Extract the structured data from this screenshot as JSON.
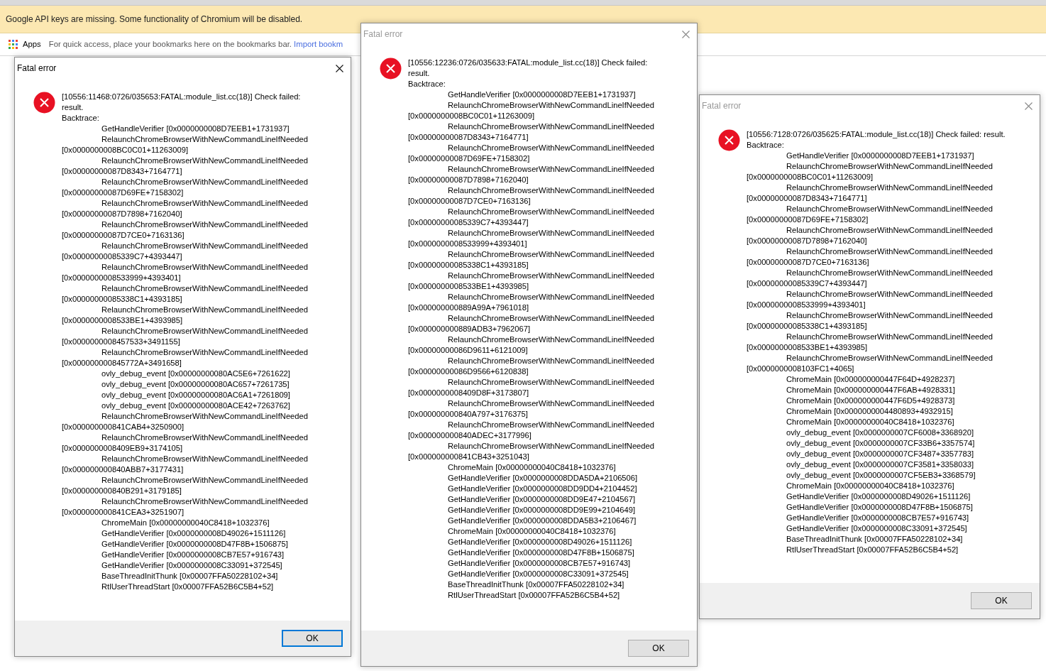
{
  "banner": {
    "text": "Google API keys are missing. Some functionality of Chromium will be disabled."
  },
  "bookmarks_bar": {
    "apps_label": "Apps",
    "hint": "For quick access, place your bookmarks here on the bookmarks bar.",
    "import_link": "Import bookm"
  },
  "dialogs": [
    {
      "title": "Fatal error",
      "active": true,
      "header": "[10556:11468:0726/035653:FATAL:module_list.cc(18)] Check failed: result.",
      "backtrace_label": "Backtrace:",
      "ok_button": "OK",
      "frames": [
        "GetHandleVerifier [0x0000000008D7EEB1+1731937]",
        "RelaunchChromeBrowserWithNewCommandLineIfNeeded [0x0000000008BC0C01+11263009]",
        "RelaunchChromeBrowserWithNewCommandLineIfNeeded [0x00000000087D8343+7164771]",
        "RelaunchChromeBrowserWithNewCommandLineIfNeeded [0x00000000087D69FE+7158302]",
        "RelaunchChromeBrowserWithNewCommandLineIfNeeded [0x00000000087D7898+7162040]",
        "RelaunchChromeBrowserWithNewCommandLineIfNeeded [0x00000000087D7CE0+7163136]",
        "RelaunchChromeBrowserWithNewCommandLineIfNeeded [0x00000000085339C7+4393447]",
        "RelaunchChromeBrowserWithNewCommandLineIfNeeded [0x0000000008533999+4393401]",
        "RelaunchChromeBrowserWithNewCommandLineIfNeeded [0x00000000085338C1+4393185]",
        "RelaunchChromeBrowserWithNewCommandLineIfNeeded [0x0000000008533BE1+4393985]",
        "RelaunchChromeBrowserWithNewCommandLineIfNeeded [0x0000000008457533+3491155]",
        "RelaunchChromeBrowserWithNewCommandLineIfNeeded [0x000000000845772A+3491658]",
        "ovly_debug_event [0x00000000080AC5E6+7261622]",
        "ovly_debug_event [0x00000000080AC657+7261735]",
        "ovly_debug_event [0x00000000080AC6A1+7261809]",
        "ovly_debug_event [0x00000000080ACE42+7263762]",
        "RelaunchChromeBrowserWithNewCommandLineIfNeeded [0x000000000841CAB4+3250900]",
        "RelaunchChromeBrowserWithNewCommandLineIfNeeded [0x0000000008409EB9+3174105]",
        "RelaunchChromeBrowserWithNewCommandLineIfNeeded [0x000000000840ABB7+3177431]",
        "RelaunchChromeBrowserWithNewCommandLineIfNeeded [0x000000000840B291+3179185]",
        "RelaunchChromeBrowserWithNewCommandLineIfNeeded [0x000000000841CEA3+3251907]",
        "ChromeMain [0x00000000040C8418+1032376]",
        "GetHandleVerifier [0x0000000008D49026+1511126]",
        "GetHandleVerifier [0x0000000008D47F8B+1506875]",
        "GetHandleVerifier [0x0000000008CB7E57+916743]",
        "GetHandleVerifier [0x0000000008C33091+372545]",
        "BaseThreadInitThunk [0x00007FFA50228102+34]",
        "RtlUserThreadStart [0x00007FFA52B6C5B4+52]"
      ]
    },
    {
      "title": "Fatal error",
      "active": false,
      "header": "[10556:12236:0726/035633:FATAL:module_list.cc(18)] Check failed: result.",
      "backtrace_label": "Backtrace:",
      "ok_button": "OK",
      "frames": [
        "GetHandleVerifier [0x0000000008D7EEB1+1731937]",
        "RelaunchChromeBrowserWithNewCommandLineIfNeeded [0x0000000008BC0C01+11263009]",
        "RelaunchChromeBrowserWithNewCommandLineIfNeeded [0x00000000087D8343+7164771]",
        "RelaunchChromeBrowserWithNewCommandLineIfNeeded [0x00000000087D69FE+7158302]",
        "RelaunchChromeBrowserWithNewCommandLineIfNeeded [0x00000000087D7898+7162040]",
        "RelaunchChromeBrowserWithNewCommandLineIfNeeded [0x00000000087D7CE0+7163136]",
        "RelaunchChromeBrowserWithNewCommandLineIfNeeded [0x00000000085339C7+4393447]",
        "RelaunchChromeBrowserWithNewCommandLineIfNeeded [0x0000000008533999+4393401]",
        "RelaunchChromeBrowserWithNewCommandLineIfNeeded [0x00000000085338C1+4393185]",
        "RelaunchChromeBrowserWithNewCommandLineIfNeeded [0x0000000008533BE1+4393985]",
        "RelaunchChromeBrowserWithNewCommandLineIfNeeded [0x000000000889A99A+7961018]",
        "RelaunchChromeBrowserWithNewCommandLineIfNeeded [0x000000000889ADB3+7962067]",
        "RelaunchChromeBrowserWithNewCommandLineIfNeeded [0x00000000086D9611+6121009]",
        "RelaunchChromeBrowserWithNewCommandLineIfNeeded [0x00000000086D9566+6120838]",
        "RelaunchChromeBrowserWithNewCommandLineIfNeeded [0x0000000008409D8F+3173807]",
        "RelaunchChromeBrowserWithNewCommandLineIfNeeded [0x000000000840A797+3176375]",
        "RelaunchChromeBrowserWithNewCommandLineIfNeeded [0x000000000840ADEC+3177996]",
        "RelaunchChromeBrowserWithNewCommandLineIfNeeded [0x000000000841CB43+3251043]",
        "ChromeMain [0x00000000040C8418+1032376]",
        "GetHandleVerifier [0x0000000008DDA5DA+2106506]",
        "GetHandleVerifier [0x0000000008DD9DD4+2104452]",
        "GetHandleVerifier [0x0000000008DD9E47+2104567]",
        "GetHandleVerifier [0x0000000008DD9E99+2104649]",
        "GetHandleVerifier [0x0000000008DDA5B3+2106467]",
        "ChromeMain [0x00000000040C8418+1032376]",
        "GetHandleVerifier [0x0000000008D49026+1511126]",
        "GetHandleVerifier [0x0000000008D47F8B+1506875]",
        "GetHandleVerifier [0x0000000008CB7E57+916743]",
        "GetHandleVerifier [0x0000000008C33091+372545]",
        "BaseThreadInitThunk [0x00007FFA50228102+34]",
        "RtlUserThreadStart [0x00007FFA52B6C5B4+52]"
      ]
    },
    {
      "title": "Fatal error",
      "active": false,
      "header": "[10556:7128:0726/035625:FATAL:module_list.cc(18)] Check failed: result.",
      "backtrace_label": "Backtrace:",
      "ok_button": "OK",
      "frames": [
        "GetHandleVerifier [0x0000000008D7EEB1+1731937]",
        "RelaunchChromeBrowserWithNewCommandLineIfNeeded [0x0000000008BC0C01+11263009]",
        "RelaunchChromeBrowserWithNewCommandLineIfNeeded [0x00000000087D8343+7164771]",
        "RelaunchChromeBrowserWithNewCommandLineIfNeeded [0x00000000087D69FE+7158302]",
        "RelaunchChromeBrowserWithNewCommandLineIfNeeded [0x00000000087D7898+7162040]",
        "RelaunchChromeBrowserWithNewCommandLineIfNeeded [0x00000000087D7CE0+7163136]",
        "RelaunchChromeBrowserWithNewCommandLineIfNeeded [0x00000000085339C7+4393447]",
        "RelaunchChromeBrowserWithNewCommandLineIfNeeded [0x0000000008533999+4393401]",
        "RelaunchChromeBrowserWithNewCommandLineIfNeeded [0x00000000085338C1+4393185]",
        "RelaunchChromeBrowserWithNewCommandLineIfNeeded [0x0000000008533BE1+4393985]",
        "RelaunchChromeBrowserWithNewCommandLineIfNeeded [0x0000000008103FC1+4065]",
        "ChromeMain [0x000000000447F64D+4928237]",
        "ChromeMain [0x000000000447F6AB+4928331]",
        "ChromeMain [0x000000000447F6D5+4928373]",
        "ChromeMain [0x0000000004480893+4932915]",
        "ChromeMain [0x00000000040C8418+1032376]",
        "ovly_debug_event [0x0000000007CF6008+3368920]",
        "ovly_debug_event [0x0000000007CF33B6+3357574]",
        "ovly_debug_event [0x0000000007CF3487+3357783]",
        "ovly_debug_event [0x0000000007CF3581+3358033]",
        "ovly_debug_event [0x0000000007CF5EB3+3368579]",
        "ChromeMain [0x00000000040C8418+1032376]",
        "GetHandleVerifier [0x0000000008D49026+1511126]",
        "GetHandleVerifier [0x0000000008D47F8B+1506875]",
        "GetHandleVerifier [0x0000000008CB7E57+916743]",
        "GetHandleVerifier [0x0000000008C33091+372545]",
        "BaseThreadInitThunk [0x00007FFA50228102+34]",
        "RtlUserThreadStart [0x00007FFA52B6C5B4+52]"
      ]
    }
  ]
}
